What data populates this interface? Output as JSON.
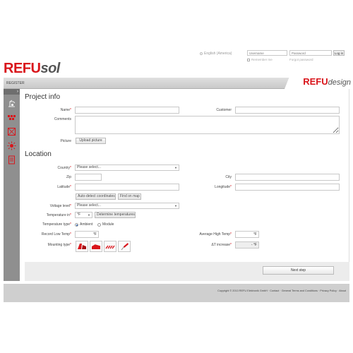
{
  "header": {
    "language": "English (America)",
    "username_placeholder": "Username",
    "password_placeholder": "Password",
    "login_label": "Log in",
    "remember_label": "Remember me",
    "forgot_label": "Forgot password"
  },
  "brand": {
    "logo_main": "REFU",
    "logo_sub": "sol",
    "design_main": "REFU",
    "design_sub": "design",
    "accent_color": "#d9151b"
  },
  "nav": {
    "register_label": "REGISTER",
    "toggle": "›"
  },
  "sidebar": {
    "icons": [
      "crane-icon",
      "modules-icon",
      "string-icon",
      "sun-icon",
      "document-icon"
    ]
  },
  "project_info": {
    "title": "Project info",
    "name_label": "Name",
    "customer_label": "Customer",
    "comments_label": "Comments",
    "picture_label": "Picture",
    "upload_label": "Upload picture"
  },
  "location": {
    "title": "Location",
    "country_label": "Country",
    "country_value": "Please select...",
    "zip_label": "Zip",
    "city_label": "City",
    "latitude_label": "Latitude",
    "longitude_label": "Longitude",
    "autodetect_label": "Auto-detect coordinates",
    "findmap_label": "Find on map",
    "voltage_label": "Voltage level",
    "voltage_value": "Please select...",
    "temp_in_label": "Temperature in",
    "temp_unit_value": "°F",
    "determine_label": "Determine temperatures",
    "temp_type_label": "Temperature type",
    "ambient_label": "Ambient",
    "module_label": "Module",
    "record_low_label": "Record Low Temp",
    "unit_f": "°F",
    "avg_high_label": "Average High Temp",
    "mounting_label": "Mounting type",
    "delta_label": "ΔT increase",
    "delta_value": "-",
    "next_label": "Next step"
  },
  "footer": {
    "copyright": "Copyright © 2013 REFU Elektronik GmbH  ·  Contact  ·  General Terms and Conditions  ·  Privacy Policy  ·  About"
  }
}
